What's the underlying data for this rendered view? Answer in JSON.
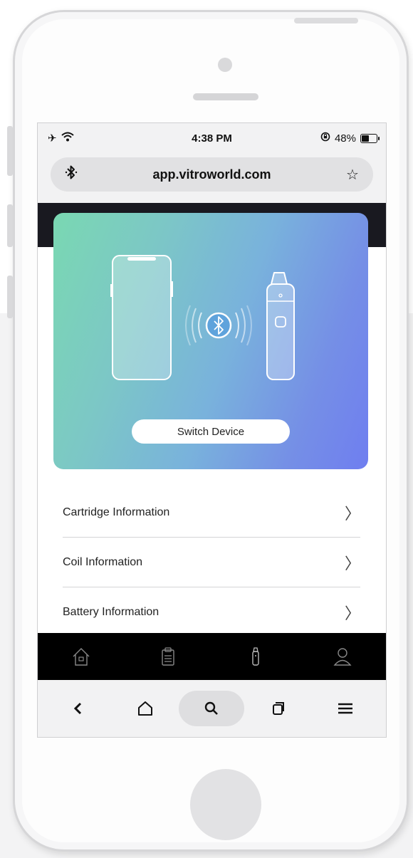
{
  "status_bar": {
    "time": "4:38 PM",
    "battery_percent": "48%",
    "battery_level": 0.48
  },
  "url_bar": {
    "left_icon": "bluetooth-icon",
    "url": "app.vitroworld.com",
    "right_icon": "star-icon"
  },
  "hero": {
    "switch_button_label": "Switch Device"
  },
  "info_list": [
    {
      "label": "Cartridge Information"
    },
    {
      "label": "Coil Information"
    },
    {
      "label": "Battery Information"
    }
  ],
  "app_tabs": [
    {
      "icon": "home-icon"
    },
    {
      "icon": "clipboard-icon"
    },
    {
      "icon": "device-icon"
    },
    {
      "icon": "profile-icon"
    }
  ],
  "browser_bar": [
    {
      "icon": "back-icon"
    },
    {
      "icon": "home-icon"
    },
    {
      "icon": "search-icon",
      "active": true
    },
    {
      "icon": "tabs-icon"
    },
    {
      "icon": "menu-icon"
    }
  ],
  "colors": {
    "hero_gradient_start": "#7ad8b2",
    "hero_gradient_end": "#6f7ef0",
    "header_dark": "#191920",
    "tabbar": "#000000"
  }
}
